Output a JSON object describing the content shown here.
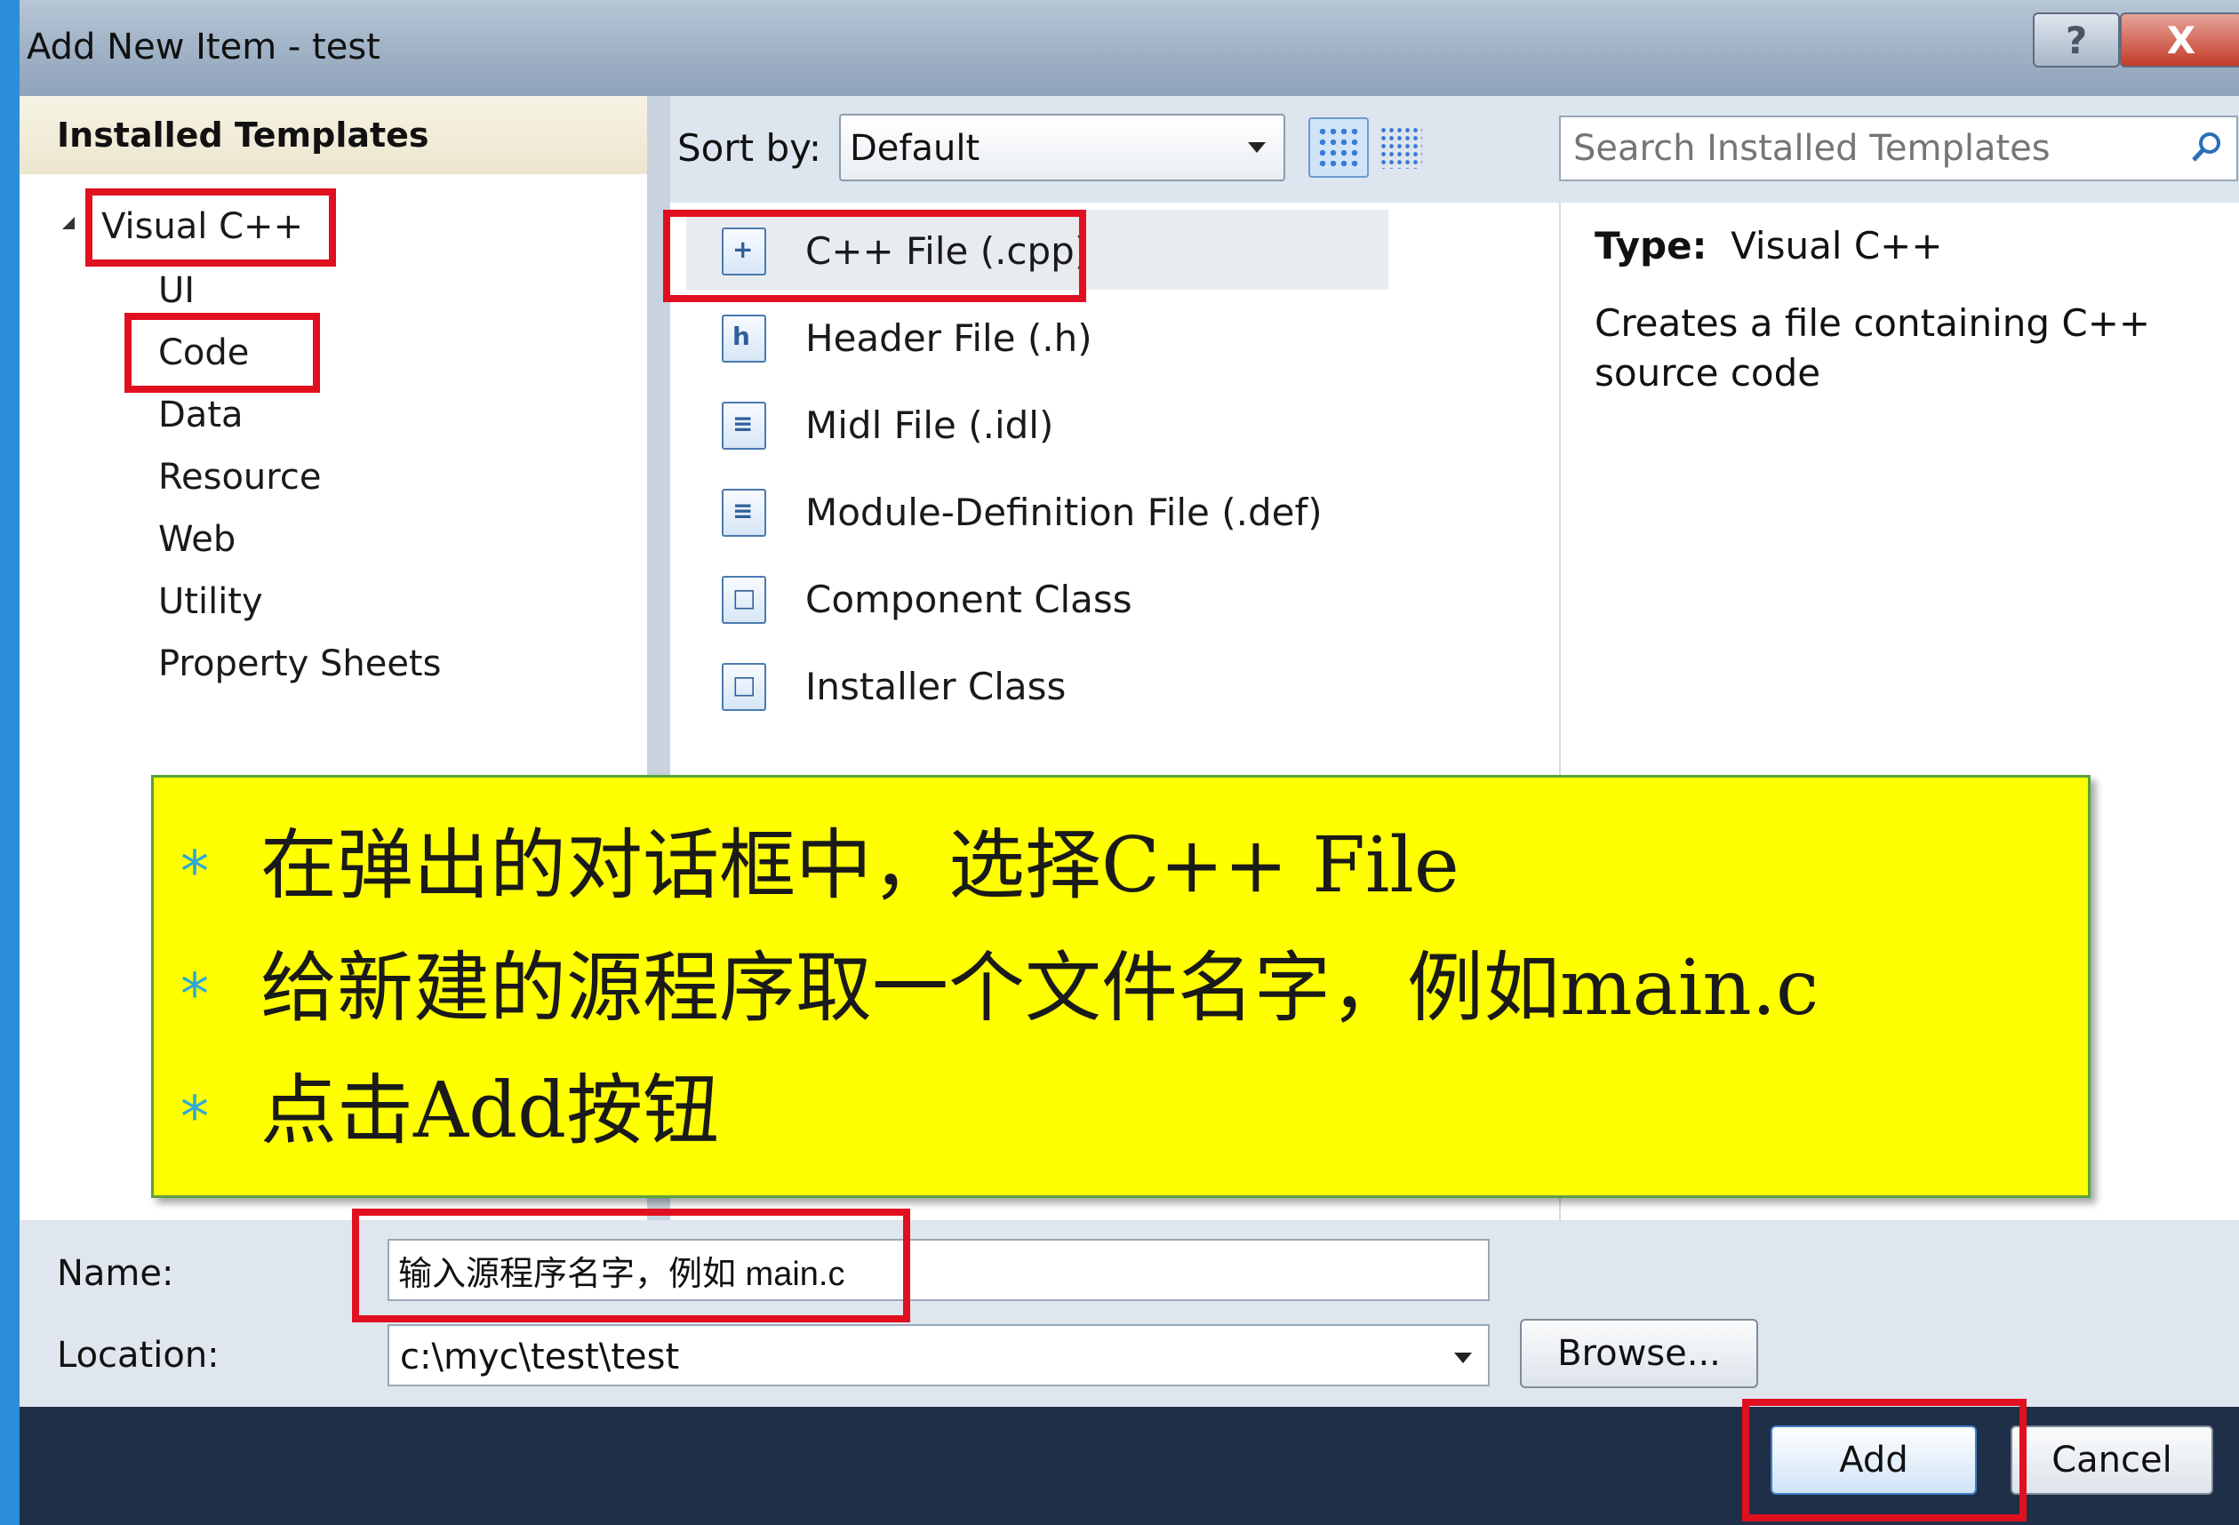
{
  "window": {
    "title": "Add New Item - test",
    "help_label": "?",
    "close_label": "X"
  },
  "left_panel": {
    "header": "Installed Templates",
    "tree": {
      "root": "Visual C++",
      "children": [
        "UI",
        "Code",
        "Data",
        "Resource",
        "Web",
        "Utility",
        "Property Sheets"
      ]
    }
  },
  "toolbar": {
    "sort_label": "Sort by:",
    "sort_value": "Default",
    "search_placeholder": "Search Installed Templates"
  },
  "templates": [
    {
      "label": "C++ File (.cpp)",
      "icon": "cpp-file-icon",
      "icon_text": "+"
    },
    {
      "label": "Header File (.h)",
      "icon": "header-file-icon",
      "icon_text": "h"
    },
    {
      "label": "Midl File (.idl)",
      "icon": "midl-file-icon",
      "icon_text": "≡"
    },
    {
      "label": "Module-Definition File (.def)",
      "icon": "def-file-icon",
      "icon_text": "≡"
    },
    {
      "label": "Component Class",
      "icon": "component-class-icon",
      "icon_text": "□"
    },
    {
      "label": "Installer Class",
      "icon": "installer-class-icon",
      "icon_text": "□"
    }
  ],
  "details": {
    "type_label": "Type:",
    "type_value": "Visual C++",
    "description": "Creates a file containing C++ source code"
  },
  "callout": {
    "bullet": "*",
    "lines": [
      "在弹出的对话框中，选择C++ File",
      "给新建的源程序取一个文件名字，例如main.c",
      "点击Add按钮"
    ]
  },
  "form": {
    "name_label": "Name:",
    "name_value": "输入源程序名字，例如 main.c",
    "location_label": "Location:",
    "location_value": "c:\\myc\\test\\test",
    "browse_label": "Browse...",
    "add_label": "Add",
    "cancel_label": "Cancel"
  },
  "colors": {
    "highlight_red": "#e01020",
    "callout_yellow": "#ffff00",
    "callout_bullet": "#2fa8d8"
  }
}
